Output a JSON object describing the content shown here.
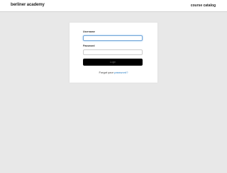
{
  "header": {
    "logo_text": "berliner academy",
    "nav_link_label": "course catalog"
  },
  "login": {
    "username_label": "Username",
    "username_value": "",
    "password_label": "Password",
    "password_value": "",
    "login_button_label": "Login",
    "forgot_prefix": "Forgot your ",
    "forgot_link_label": "password?"
  },
  "colors": {
    "page_background": "#e8e8e8",
    "header_background": "#ffffff",
    "card_background": "#ffffff",
    "button_background": "#000000",
    "link_color": "#2a7fc4",
    "focus_border": "#74a6d8"
  }
}
